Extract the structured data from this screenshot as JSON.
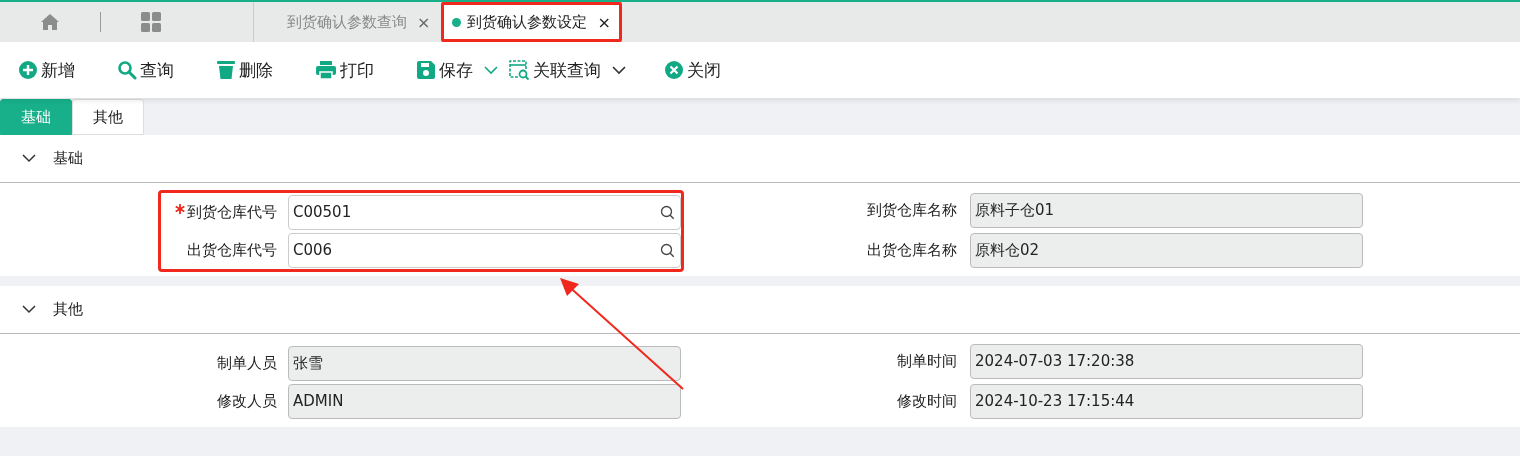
{
  "tabs": [
    {
      "label": "到货确认参数查询",
      "close": "×",
      "selected": false,
      "highlighted": false
    },
    {
      "label": "到货确认参数设定",
      "close": "×",
      "selected": true,
      "highlighted": true
    }
  ],
  "toolbar": [
    {
      "label": "新增",
      "kind": "add",
      "dropdown": false
    },
    {
      "label": "查询",
      "kind": "search",
      "dropdown": false
    },
    {
      "label": "删除",
      "kind": "delete",
      "dropdown": false
    },
    {
      "label": "打印",
      "kind": "print",
      "dropdown": false
    },
    {
      "label": "保存",
      "kind": "save",
      "dropdown": true
    },
    {
      "label": "关联查询",
      "kind": "related",
      "dropdown": true
    },
    {
      "label": "关闭",
      "kind": "close",
      "dropdown": false
    }
  ],
  "subtabs": [
    {
      "label": "基础",
      "selected": true
    },
    {
      "label": "其他",
      "selected": false
    }
  ],
  "sections": [
    {
      "title": "基础",
      "expanded": true,
      "left_highlighted": true,
      "rows": [
        {
          "left": {
            "label": "到货仓库代号",
            "value": "C00501",
            "kind": "lookup",
            "required": true
          },
          "right": {
            "label": "到货仓库名称",
            "value": "原料子仓01",
            "kind": "readonly",
            "required": false
          }
        },
        {
          "left": {
            "label": "出货仓库代号",
            "value": "C006",
            "kind": "lookup",
            "required": false
          },
          "right": {
            "label": "出货仓库名称",
            "value": "原料仓02",
            "kind": "readonly",
            "required": false
          }
        }
      ]
    },
    {
      "title": "其他",
      "expanded": true,
      "left_highlighted": false,
      "rows": [
        {
          "left": {
            "label": "制单人员",
            "value": "张雪",
            "kind": "readonly",
            "required": false
          },
          "right": {
            "label": "制单时间",
            "value": "2024-07-03 17:20:38",
            "kind": "readonly",
            "required": false
          }
        },
        {
          "left": {
            "label": "修改人员",
            "value": "ADMIN",
            "kind": "readonly",
            "required": false
          },
          "right": {
            "label": "修改时间",
            "value": "2024-10-23 17:15:44",
            "kind": "readonly",
            "required": false
          }
        }
      ]
    }
  ]
}
